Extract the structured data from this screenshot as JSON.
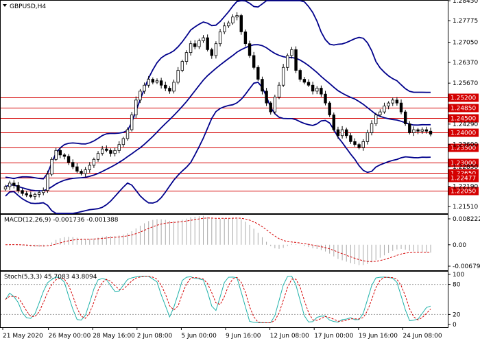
{
  "symbol_label": "GBPUSD,H4",
  "macd": {
    "label": "MACD(12,26,9) -0.001736 -0.001388"
  },
  "stoch": {
    "label": "Stoch(5,3,3) 45.7083 43.8094"
  },
  "chart_data": {
    "type": "candlestick",
    "price_axis": {
      "range": [
        1.2128,
        1.2845
      ],
      "ticks": [
        "1.28450",
        "1.27775",
        "1.27050",
        "1.26370",
        "1.25670",
        "1.24290",
        "1.23600",
        "1.22850",
        "1.22190",
        "1.21510"
      ]
    },
    "levels": [
      {
        "value": 1.252,
        "label": "1.25200"
      },
      {
        "value": 1.2485,
        "label": "1.24850"
      },
      {
        "value": 1.245,
        "label": "1.24500"
      },
      {
        "value": 1.24,
        "label": "1.24000"
      },
      {
        "value": 1.235,
        "label": "1.23500"
      },
      {
        "value": 1.23,
        "label": "1.23000"
      },
      {
        "value": 1.2265,
        "label": "1.22650"
      },
      {
        "value": 1.22477,
        "label": "1.22477"
      },
      {
        "value": 1.2205,
        "label": "1.22050"
      }
    ],
    "x_labels": [
      "21 May 2020",
      "26 May 00:00",
      "28 May 16:00",
      "2 Jun 08:00",
      "5 Jun 00:00",
      "9 Jun 16:00",
      "12 Jun 08:00",
      "17 Jun 00:00",
      "19 Jun 16:00",
      "24 Jun 08:00"
    ],
    "close": [
      1.2218,
      1.223,
      1.2222,
      1.2205,
      1.2195,
      1.219,
      1.2185,
      1.2192,
      1.2198,
      1.2205,
      1.226,
      1.231,
      1.234,
      1.2325,
      1.232,
      1.23,
      1.2285,
      1.227,
      1.2262,
      1.2275,
      1.229,
      1.231,
      1.233,
      1.2345,
      1.234,
      1.233,
      1.234,
      1.236,
      1.238,
      1.241,
      1.246,
      1.251,
      1.254,
      1.256,
      1.258,
      1.257,
      1.2575,
      1.256,
      1.255,
      1.254,
      1.257,
      1.261,
      1.264,
      1.267,
      1.27,
      1.269,
      1.271,
      1.272,
      1.268,
      1.266,
      1.27,
      1.274,
      1.276,
      1.277,
      1.279,
      1.2795,
      1.274,
      1.27,
      1.266,
      1.262,
      1.258,
      1.254,
      1.25,
      1.247,
      1.252,
      1.256,
      1.262,
      1.266,
      1.268,
      1.261,
      1.258,
      1.257,
      1.256,
      1.254,
      1.255,
      1.253,
      1.25,
      1.246,
      1.241,
      1.239,
      1.241,
      1.239,
      1.237,
      1.236,
      1.235,
      1.237,
      1.24,
      1.243,
      1.246,
      1.247,
      1.249,
      1.25,
      1.251,
      1.25,
      1.247,
      1.243,
      1.24,
      1.241,
      1.2405,
      1.241,
      1.2405,
      1.2395
    ],
    "bollinger": {
      "period": 20,
      "deviations": 2
    },
    "macd": {
      "params": "12,26,9",
      "main": -0.001736,
      "signal": -0.001388,
      "ticks": [
        "0.008222",
        "0.00",
        "-0.006791"
      ],
      "range": [
        -0.006791,
        0.008222
      ]
    },
    "stochastic": {
      "params": "5,3,3",
      "k": 45.7083,
      "d": 43.8094,
      "ticks": [
        "100",
        "80",
        "20",
        "0"
      ]
    }
  }
}
